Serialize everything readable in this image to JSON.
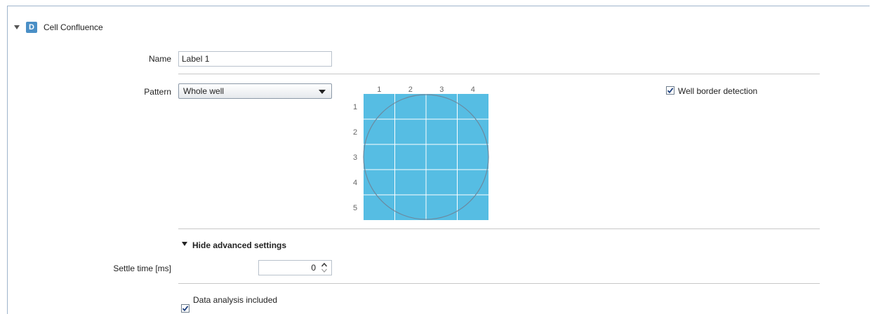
{
  "section": {
    "badge": "D",
    "title": "Cell Confluence"
  },
  "name_field": {
    "label": "Name",
    "value": "Label 1"
  },
  "pattern": {
    "label": "Pattern",
    "selected": "Whole well",
    "columns": [
      "1",
      "2",
      "3",
      "4"
    ],
    "rows": [
      "1",
      "2",
      "3",
      "4",
      "5"
    ],
    "fill_color": "#56bde3"
  },
  "well_border": {
    "label": "Well border detection",
    "checked": true
  },
  "advanced": {
    "toggle_label": "Hide advanced settings"
  },
  "settle_time": {
    "label": "Settle time [ms]",
    "value": "0"
  },
  "data_analysis": {
    "label": "Data analysis included",
    "checked": true
  }
}
